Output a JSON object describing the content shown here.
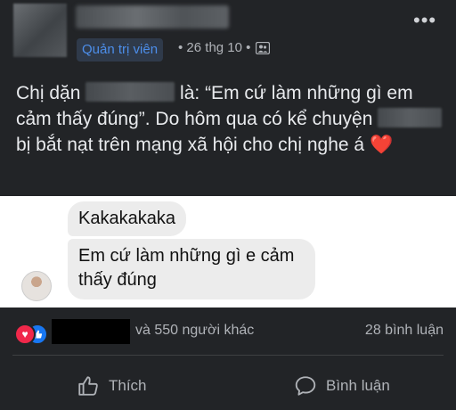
{
  "post": {
    "role_badge": "Quản trị viên",
    "date": "• 26 thg 10 •",
    "text_part1": "Chị dặn ",
    "text_part2": " là: “Em cứ làm những gì em cảm thấy đúng”. Do hôm qua có kể chuyện ",
    "text_part3": " bị bắt nạt trên mạng xã hội cho chị nghe á ",
    "heart": "❤️"
  },
  "chat": {
    "messages": [
      "Kakakakaka",
      "Em cứ làm những gì e cảm thấy đúng"
    ]
  },
  "footer": {
    "others_text": "và 550 người khác",
    "comments_text": "28 bình luận",
    "like_label": "Thích",
    "comment_label": "Bình luận"
  },
  "icons": {
    "more": "more-options-icon",
    "group": "group-icon",
    "love": "love-reaction-icon",
    "like": "like-reaction-icon",
    "like_action": "thumbs-up-icon",
    "comment_action": "comment-bubble-icon"
  },
  "colors": {
    "background": "#222427",
    "badge_text": "#4c8eea",
    "love": "#f0284a",
    "like": "#1877f2"
  }
}
